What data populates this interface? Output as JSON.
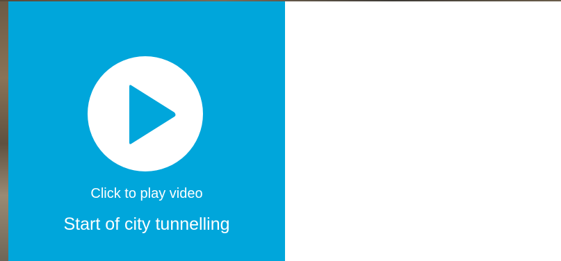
{
  "video_card": {
    "play_label": "Click to play video",
    "title": "Start of city tunnelling",
    "accent_color": "#00a6db",
    "icon": "play-icon"
  }
}
